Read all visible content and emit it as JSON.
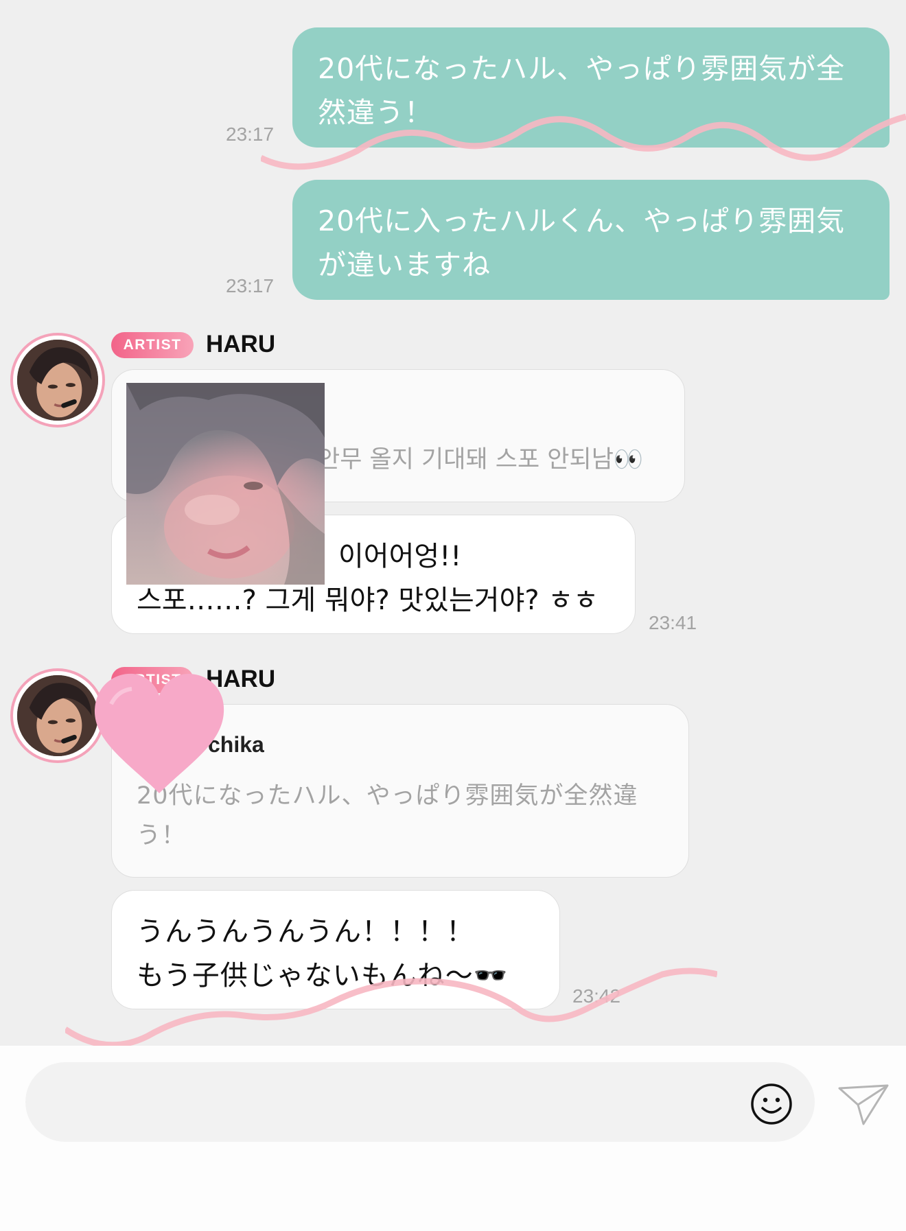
{
  "messages": {
    "sent": [
      {
        "text_line1": "20代になったハル、やっぱり雰囲気が全",
        "text_line2": "然違う！",
        "time": "23:17"
      },
      {
        "text_line1": "20代に入ったハルくん、やっぱり雰囲気",
        "text_line2": "が違いますね",
        "time": "23:17"
      }
    ],
    "received": [
      {
        "badge": "ARTIST",
        "sender": "HARU",
        "quote_text": "안무 올지 기대돼 스포 안되남👀",
        "reply_line1": "이어어엉!!",
        "reply_line2": "스포……? 그게 뭐야? 맛있는거야? ㅎㅎ",
        "time": "23:41"
      },
      {
        "badge": "ARTIST",
        "sender": "HARU",
        "quote_name": "chika",
        "quote_text": "20代になったハル、やっぱり雰囲気が全然違う！",
        "reply_line1": "うんうんうんうん！！！！",
        "reply_line2": "もう子供じゃないもんね〜🕶️",
        "time": "23:42"
      }
    ]
  },
  "input": {
    "placeholder": ""
  },
  "colors": {
    "sent_bubble": "#93d0c5",
    "artist_badge": "#f26489",
    "avatar_ring": "#f4a2b9",
    "timestamp": "#a3a3a3",
    "wave": "#f7b7c2",
    "heart": "#f7a9c8"
  },
  "icons": {
    "emoji": "smiley-face-icon",
    "send": "paper-plane-icon"
  }
}
